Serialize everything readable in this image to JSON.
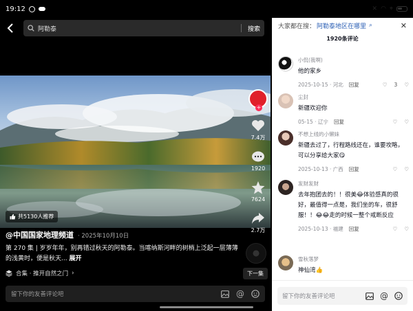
{
  "status": {
    "time": "19:12"
  },
  "search": {
    "query": "阿勒泰",
    "button": "搜索"
  },
  "video": {
    "recommend_badge": "共5130人推荐",
    "author": "@中国国家地理频道",
    "date": "· 2025年10月10日",
    "desc_main": "第 270 集 | 岁岁年年，别再错过秋天的阿勒泰。当喀纳斯河畔的树梢上泛起一层薄薄的浅黄时，便是秋天...",
    "desc_expand": "展开",
    "collection": "合集 · 推开自然之门",
    "next_label": "下一集",
    "likes": "7.4万",
    "comments": "1920",
    "stars": "7624",
    "shares": "2.7万",
    "comment_placeholder": "留下你的友善评论吧"
  },
  "panel": {
    "search_label": "大家都在搜：",
    "search_link": "阿勒泰地区在哪里",
    "count": "1920条评论",
    "input_placeholder": "留下你的友善评论吧"
  },
  "comments": [
    {
      "user": "小侃(我啊)",
      "text": "他的家乡",
      "date": "2025-10-15 · 河北",
      "reply": "回复",
      "likes": "3"
    },
    {
      "user": "尘封",
      "text": "新疆欢迎你",
      "date": "05-15 · 辽宁",
      "reply": "回复",
      "likes": ""
    },
    {
      "user": "不想上线的小懒妹",
      "text": "新疆去过了，行程路线还在，谁要攻略，可以分享给大家😋",
      "date": "2025-10-13 · 广西",
      "reply": "回复",
      "likes": ""
    },
    {
      "user": "发财发财",
      "text": "去年抱团去的！！很美😂体验感真的很好，最值得一点是，我们坐的车，很舒服！！😂😂走的时候一整个戒断反应",
      "date": "2025-10-13 · 福建",
      "reply": "回复",
      "likes": ""
    },
    {
      "user": "雪秋落梦",
      "text": "神仙湾👍",
      "date": "",
      "reply": "",
      "likes": ""
    }
  ],
  "colors": {
    "accent": "#fe2c55",
    "link": "#2b5fb4",
    "panel_bg": "#ffffff"
  }
}
